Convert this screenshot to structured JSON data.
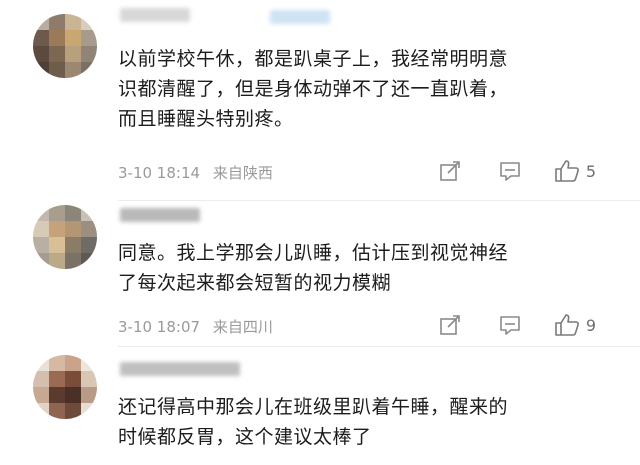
{
  "comments": [
    {
      "text_lines": [
        "以前学校午休，都是趴桌子上，我经常明明意",
        "识都清醒了，但是身体动弹不了还一直趴着，",
        "而且睡醒头特别疼。"
      ],
      "date": "3-10 18:14",
      "location": "来自陕西",
      "likes": "5"
    },
    {
      "text_lines": [
        "同意。我上学那会儿趴睡，估计压到视觉神经",
        "了每次起来都会短暂的视力模糊"
      ],
      "date": "3-10 18:07",
      "location": "来自四川",
      "likes": "9"
    },
    {
      "text_lines": [
        "还记得高中那会儿在班级里趴着午睡，醒来的",
        "时候都反胃，这个建议太棒了"
      ]
    }
  ],
  "icons": {
    "share": "share-icon",
    "comment": "comment-icon",
    "like": "thumbs-up-icon"
  }
}
